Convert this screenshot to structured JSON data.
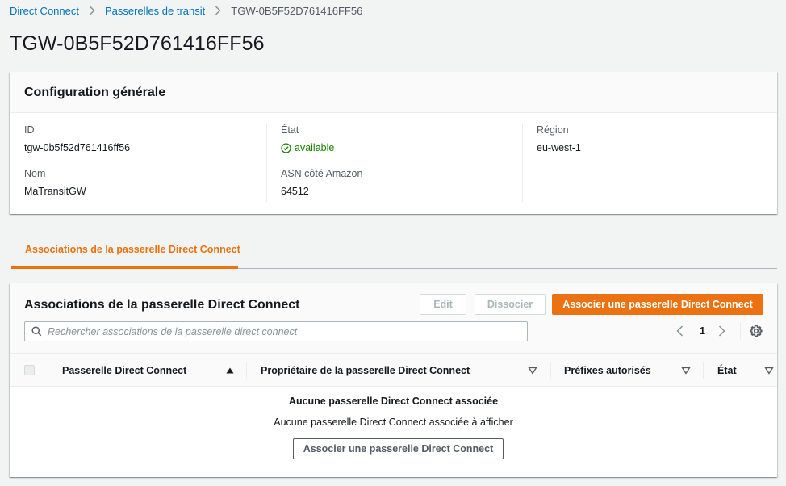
{
  "breadcrumb": {
    "items": [
      "Direct Connect",
      "Passerelles de transit"
    ],
    "current": "TGW-0B5F52D761416FF56"
  },
  "page_title": "TGW-0B5F52D761416FF56",
  "config": {
    "title": "Configuration générale",
    "id_label": "ID",
    "id_value": "tgw-0b5f52d761416ff56",
    "name_label": "Nom",
    "name_value": "MaTransitGW",
    "state_label": "État",
    "state_value": "available",
    "asn_label": "ASN côté Amazon",
    "asn_value": "64512",
    "region_label": "Région",
    "region_value": "eu-west-1"
  },
  "tabs": [
    {
      "label": "Associations de la passerelle Direct Connect",
      "active": true
    }
  ],
  "associations": {
    "title": "Associations de la passerelle Direct Connect",
    "edit_label": "Edit",
    "dissociate_label": "Dissocier",
    "associate_label": "Associer une passerelle Direct Connect",
    "search_placeholder": "Rechercher associations de la passerelle direct connect",
    "page": "1",
    "columns": [
      "Passerelle Direct Connect",
      "Propriétaire de la passerelle Direct Connect",
      "Préfixes autorisés",
      "État"
    ],
    "empty_title": "Aucune passerelle Direct Connect associée",
    "empty_desc": "Aucune passerelle Direct Connect associée à afficher",
    "empty_button": "Associer une passerelle Direct Connect"
  },
  "colors": {
    "link": "#0073bb",
    "accent": "#ec7211",
    "success": "#1d8102",
    "text": "#16191f",
    "muted": "#545b64"
  },
  "icons": [
    "chevron-right-icon",
    "check-circle-icon",
    "search-icon",
    "chevron-left-icon",
    "gear-icon",
    "sort-ascending-icon",
    "sort-descending-icon"
  ]
}
